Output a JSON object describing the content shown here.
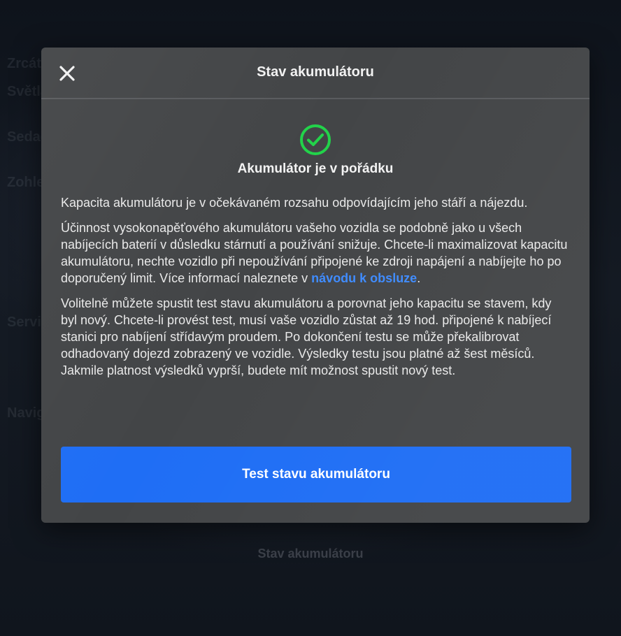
{
  "background": {
    "ghost_labels": [
      "Zrcátka",
      "Světla",
      "Sedadla",
      "Zohlednit",
      "Servis",
      "Navigace"
    ],
    "ghost_bottom_title": "Stav akumulátoru"
  },
  "dialog": {
    "title": "Stav akumulátoru",
    "close_icon": "close-icon",
    "status_icon": "check-circle-icon",
    "status_color": "#22d34a",
    "status_text": "Akumulátor je v pořádku",
    "paragraph1": "Kapacita akumulátoru je v očekávaném rozsahu odpovídajícím jeho stáří a nájezdu.",
    "paragraph2_text": "Účinnost vysokonapěťového akumulátoru vašeho vozidla se podobně jako u všech nabíjecích baterií v důsledku stárnutí a používání snižuje. Chcete-li maximalizovat kapacitu akumulátoru, nechte vozidlo při nepoužívání připojené ke zdroji napájení a nabíjejte ho po doporučený limit. Více informací naleznete v ",
    "paragraph2_link": "návodu k obsluze",
    "paragraph2_end": ".",
    "paragraph3": "Volitelně můžete spustit test stavu akumulátoru a porovnat jeho kapacitu se stavem, kdy byl nový. Chcete-li provést test, musí vaše vozidlo zůstat až 19 hod. připojené k nabíjecí stanici pro nabíjení střídavým proudem. Po dokončení testu se může překalibrovat odhadovaný dojezd zobrazený ve vozidle. Výsledky testu jsou platné až šest měsíců. Jakmile platnost výsledků vyprší, budete mít možnost spustit nový test.",
    "button_label": "Test stavu akumulátoru",
    "accent_color": "#1f6ef5",
    "link_color": "#3e8bff"
  }
}
